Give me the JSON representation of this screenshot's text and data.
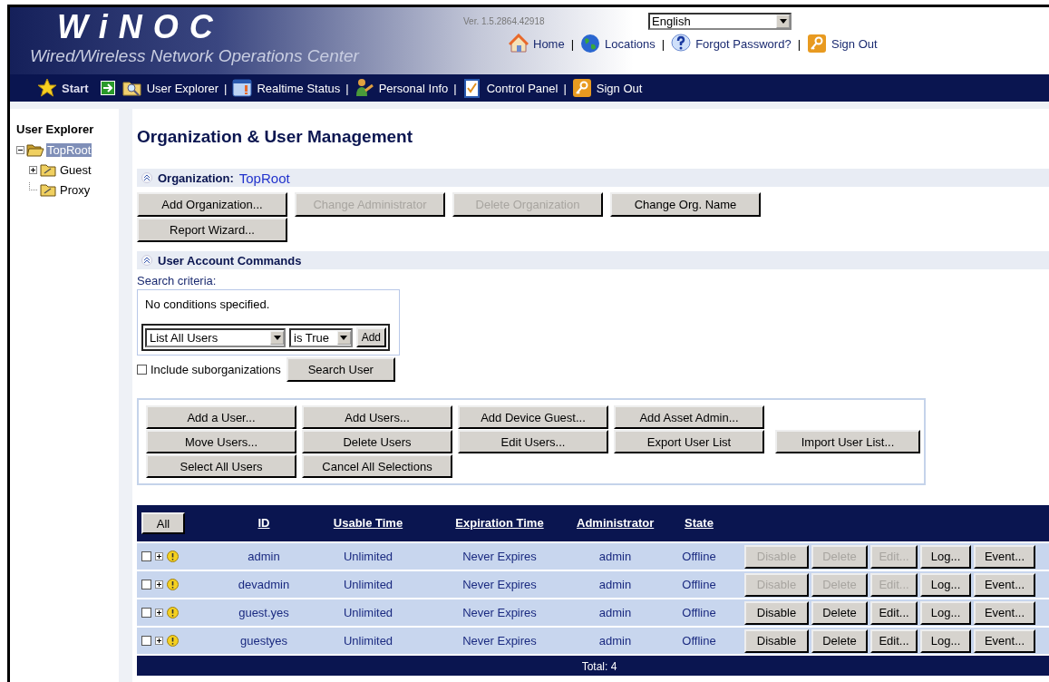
{
  "header": {
    "separator": "|",
    "logo": "WiNOC",
    "subtitle": "Wired/Wireless Network Operations Center",
    "version": "Ver. 1.5.2864.42918",
    "language": "English",
    "links": [
      {
        "label": "Home",
        "kind": "home"
      },
      {
        "label": "Locations",
        "kind": "globe"
      },
      {
        "label": "Forgot Password?",
        "kind": "help"
      },
      {
        "label": "Sign Out",
        "kind": "key"
      }
    ]
  },
  "nav_separator": "|",
  "nav": [
    {
      "label": "Start",
      "kind": "star"
    },
    {
      "label": "User Explorer",
      "kind": "explorer"
    },
    {
      "label": "Realtime Status",
      "kind": "status"
    },
    {
      "label": "Personal Info",
      "kind": "person"
    },
    {
      "label": "Control Panel",
      "kind": "panel"
    },
    {
      "label": "Sign Out",
      "kind": "key"
    }
  ],
  "sidebar": {
    "title": "User Explorer",
    "tree": [
      {
        "label": "TopRoot",
        "selected": true,
        "expanded": true,
        "children": [
          {
            "label": "Guest",
            "selected": false,
            "expanded": false
          },
          {
            "label": "Proxy",
            "selected": false
          }
        ]
      }
    ]
  },
  "main": {
    "title": "Organization & User Management",
    "organization": {
      "label": "Organization:",
      "value": "TopRoot",
      "buttons": [
        {
          "label": "Add Organization...",
          "disabled": false
        },
        {
          "label": "Change Administrator",
          "disabled": true
        },
        {
          "label": "Delete Organization",
          "disabled": true
        },
        {
          "label": "Change Org. Name",
          "disabled": false
        },
        {
          "label": "Report Wizard...",
          "disabled": false
        }
      ]
    },
    "user_commands": {
      "title": "User Account Commands",
      "search_label": "Search criteria:",
      "conditions": "No conditions specified.",
      "field": "List All Users",
      "operator": "is True",
      "add_button": "Add",
      "include_sub": {
        "label": "Include suborganizations",
        "checked": false
      },
      "search_button": "Search User",
      "buttons": [
        [
          "Add a User...",
          "Add Users...",
          "Add Device Guest...",
          "Add Asset Admin..."
        ],
        [
          "Move Users...",
          "Delete Users",
          "Edit Users...",
          "Export User List",
          "Import User List..."
        ],
        [
          "Select All Users",
          "Cancel All Selections"
        ]
      ]
    },
    "table": {
      "all_button": "All",
      "columns": [
        "ID",
        "Usable Time",
        "Expiration Time",
        "Administrator",
        "State"
      ],
      "rows": [
        {
          "checked": false,
          "cells": [
            "admin",
            "Unlimited",
            "Never Expires",
            "admin",
            "Offline"
          ],
          "actions": [
            {
              "label": "Disable",
              "disabled": true
            },
            {
              "label": "Delete",
              "disabled": true
            },
            {
              "label": "Edit...",
              "disabled": true
            },
            {
              "label": "Log...",
              "disabled": false
            },
            {
              "label": "Event...",
              "disabled": false
            }
          ]
        },
        {
          "checked": false,
          "cells": [
            "devadmin",
            "Unlimited",
            "Never Expires",
            "admin",
            "Offline"
          ],
          "actions": [
            {
              "label": "Disable",
              "disabled": true
            },
            {
              "label": "Delete",
              "disabled": true
            },
            {
              "label": "Edit...",
              "disabled": true
            },
            {
              "label": "Log...",
              "disabled": false
            },
            {
              "label": "Event...",
              "disabled": false
            }
          ]
        },
        {
          "checked": false,
          "cells": [
            "guest.yes",
            "Unlimited",
            "Never Expires",
            "admin",
            "Offline"
          ],
          "actions": [
            {
              "label": "Disable",
              "disabled": false
            },
            {
              "label": "Delete",
              "disabled": false
            },
            {
              "label": "Edit...",
              "disabled": false
            },
            {
              "label": "Log...",
              "disabled": false
            },
            {
              "label": "Event...",
              "disabled": false
            }
          ]
        },
        {
          "checked": false,
          "cells": [
            "guestyes",
            "Unlimited",
            "Never Expires",
            "admin",
            "Offline"
          ],
          "actions": [
            {
              "label": "Disable",
              "disabled": false
            },
            {
              "label": "Delete",
              "disabled": false
            },
            {
              "label": "Edit...",
              "disabled": false
            },
            {
              "label": "Log...",
              "disabled": false
            },
            {
              "label": "Event...",
              "disabled": false
            }
          ]
        }
      ],
      "footer": "Total: 4"
    }
  }
}
